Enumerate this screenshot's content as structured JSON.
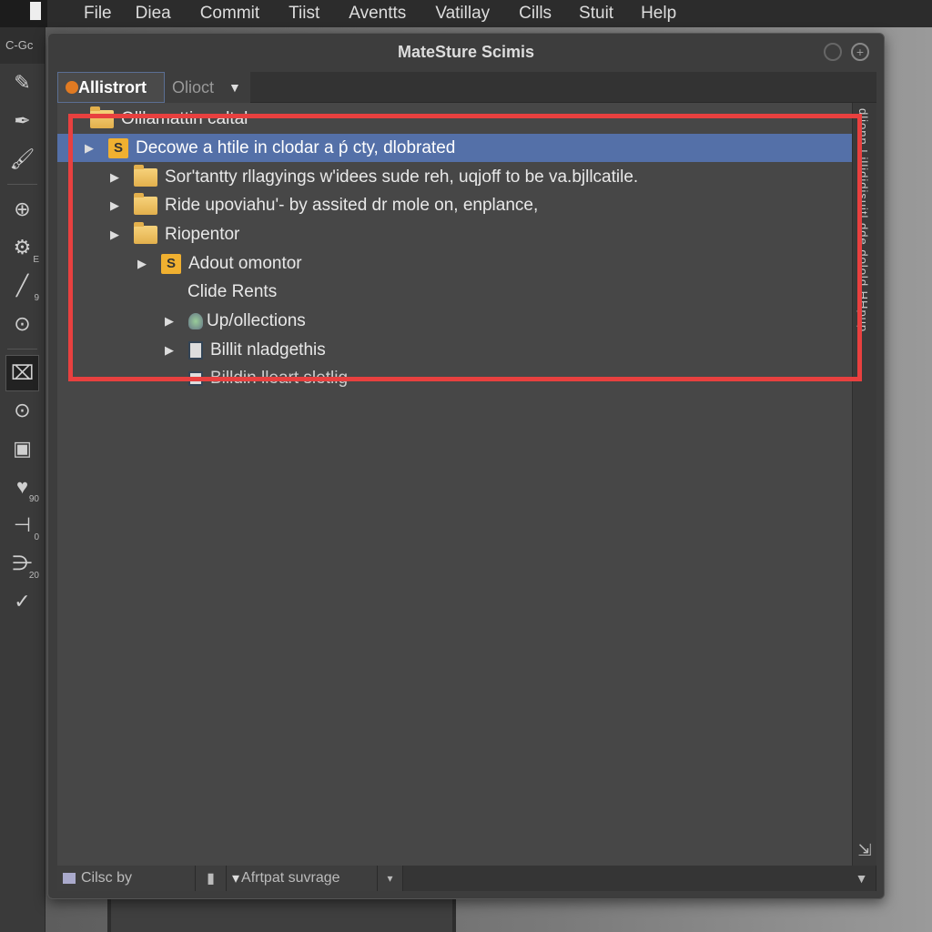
{
  "menubar": {
    "items": [
      "File",
      "Diea",
      "Commit",
      "Tiist",
      "Aventts",
      "Vatillay",
      "Cills",
      "Stuit",
      "Help"
    ]
  },
  "toolbar": {
    "header": "C-Gc",
    "tools": [
      {
        "icon": "edit-icon"
      },
      {
        "icon": "pen-icon"
      },
      {
        "icon": "brush-icon"
      },
      {
        "icon": "target-icon"
      },
      {
        "icon": "person-settings-icon",
        "sub": "E"
      },
      {
        "icon": "line-icon",
        "sub": "9"
      },
      {
        "icon": "download-icon"
      },
      {
        "icon": "film-icon"
      },
      {
        "icon": "stamp-icon"
      },
      {
        "icon": "frame-icon"
      },
      {
        "icon": "shape-icon",
        "sub": "90"
      },
      {
        "icon": "vector-icon",
        "sub": "0"
      },
      {
        "icon": "branch-icon",
        "sub": "20"
      },
      {
        "icon": "check-circle-icon"
      }
    ]
  },
  "dialog": {
    "title": "MateSture Scimis",
    "tabs": [
      {
        "label": "Allistrort",
        "active": true
      },
      {
        "label": "Olioct"
      }
    ],
    "tree": [
      {
        "label": "Olllamattin caltal",
        "icon": "folder-icon",
        "level": 0,
        "arrow": false
      },
      {
        "label": "Decowe a htile in clodar a ṕ cty, dlobrated",
        "icon": "s-badge-icon",
        "level": 0,
        "arrow": true,
        "selected": true
      },
      {
        "label": "Sor'tantty rllagyings w'idees sude reh, uqjoff to be va.bjllcatile.",
        "icon": "folder-icon",
        "level": 1,
        "arrow": true
      },
      {
        "label": "Ride upoviahu'- by assited dr mole on, enplance,",
        "icon": "folder-icon",
        "level": 1,
        "arrow": true
      },
      {
        "label": "Riopentor",
        "icon": "folder-icon",
        "level": 1,
        "arrow": true
      },
      {
        "label": "Adout omontor",
        "icon": "s-badge-icon",
        "level": 2,
        "arrow": true
      },
      {
        "label": "Clide Rents",
        "icon": "",
        "level": 2,
        "arrow": false
      },
      {
        "label": "Up/ollections",
        "icon": "bulb-icon",
        "level": 3,
        "arrow": true
      },
      {
        "label": "Billit nladgethis",
        "icon": "document-icon",
        "level": 3,
        "arrow": true
      },
      {
        "label": "Billdin lleart sletlig",
        "icon": "document-icon",
        "level": 3,
        "arrow": false
      }
    ],
    "side_text": "dlionn Lillididisuitl dde dolold HHpup",
    "statusbar": {
      "left": "Cilsc by",
      "middle": "Afrtpat suvrage"
    },
    "highlight_color": "#e8403f",
    "selection_color": "#5470a8"
  }
}
